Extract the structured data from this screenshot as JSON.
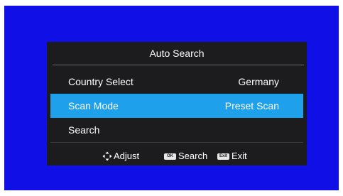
{
  "menu": {
    "title": "Auto Search",
    "rows": [
      {
        "label": "Country Select",
        "value": "Germany",
        "selected": false
      },
      {
        "label": "Scan Mode",
        "value": "Preset Scan",
        "selected": true
      },
      {
        "label": "Search",
        "value": "",
        "selected": false
      }
    ]
  },
  "footer": {
    "adjust": {
      "icon": "dpad-icon",
      "label": "Adjust"
    },
    "search": {
      "key": "OK",
      "label": "Search"
    },
    "exit": {
      "key": "Exit",
      "label": "Exit"
    }
  },
  "colors": {
    "background": "#1010e6",
    "panel": "#1c1c1e",
    "highlight": "#1ea0ea"
  }
}
